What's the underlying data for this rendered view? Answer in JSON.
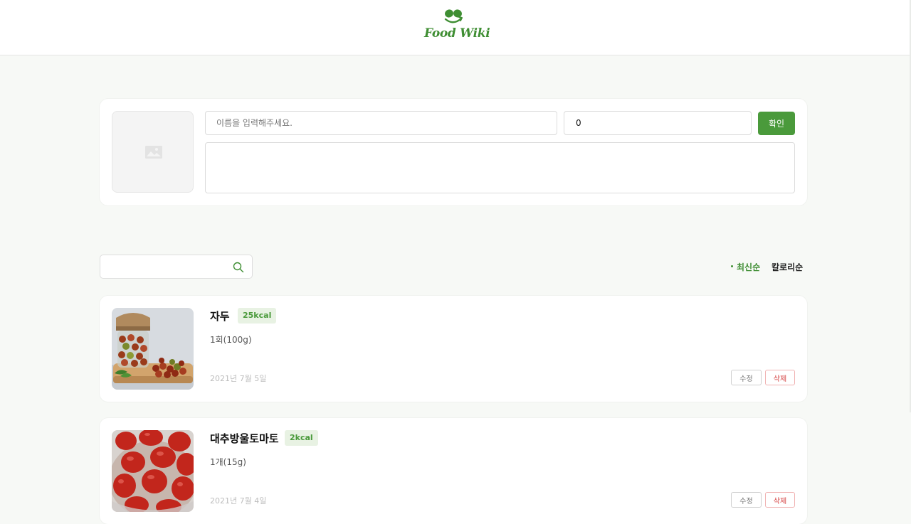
{
  "header": {
    "logo_text": "Food Wiki",
    "brand_color": "#3f8e33"
  },
  "form": {
    "name_placeholder": "이름을 입력해주세요.",
    "kcal_value": "0",
    "confirm_label": "확인",
    "image_placeholder_icon": "image-icon"
  },
  "toolbar": {
    "search_value": "",
    "search_icon": "search-icon",
    "sort_latest": "최신순",
    "sort_calorie": "칼로리순",
    "active_sort": "latest"
  },
  "foods": [
    {
      "name": "자두",
      "kcal": "25kcal",
      "serving": "1회(100g)",
      "date": "2021년 7월 5일",
      "edit_label": "수정",
      "delete_label": "삭제",
      "image": "jar-of-cherry-tomatoes"
    },
    {
      "name": "대추방울토마토",
      "kcal": "2kcal",
      "serving": "1개(15g)",
      "date": "2021년 7월 4일",
      "edit_label": "수정",
      "delete_label": "삭제",
      "image": "bowl-of-tomatoes"
    }
  ],
  "colors": {
    "accent": "#4a9a3b",
    "badge_bg": "#e8f2e3",
    "delete": "#d33b3b",
    "page_bg": "#f7f9f6"
  }
}
